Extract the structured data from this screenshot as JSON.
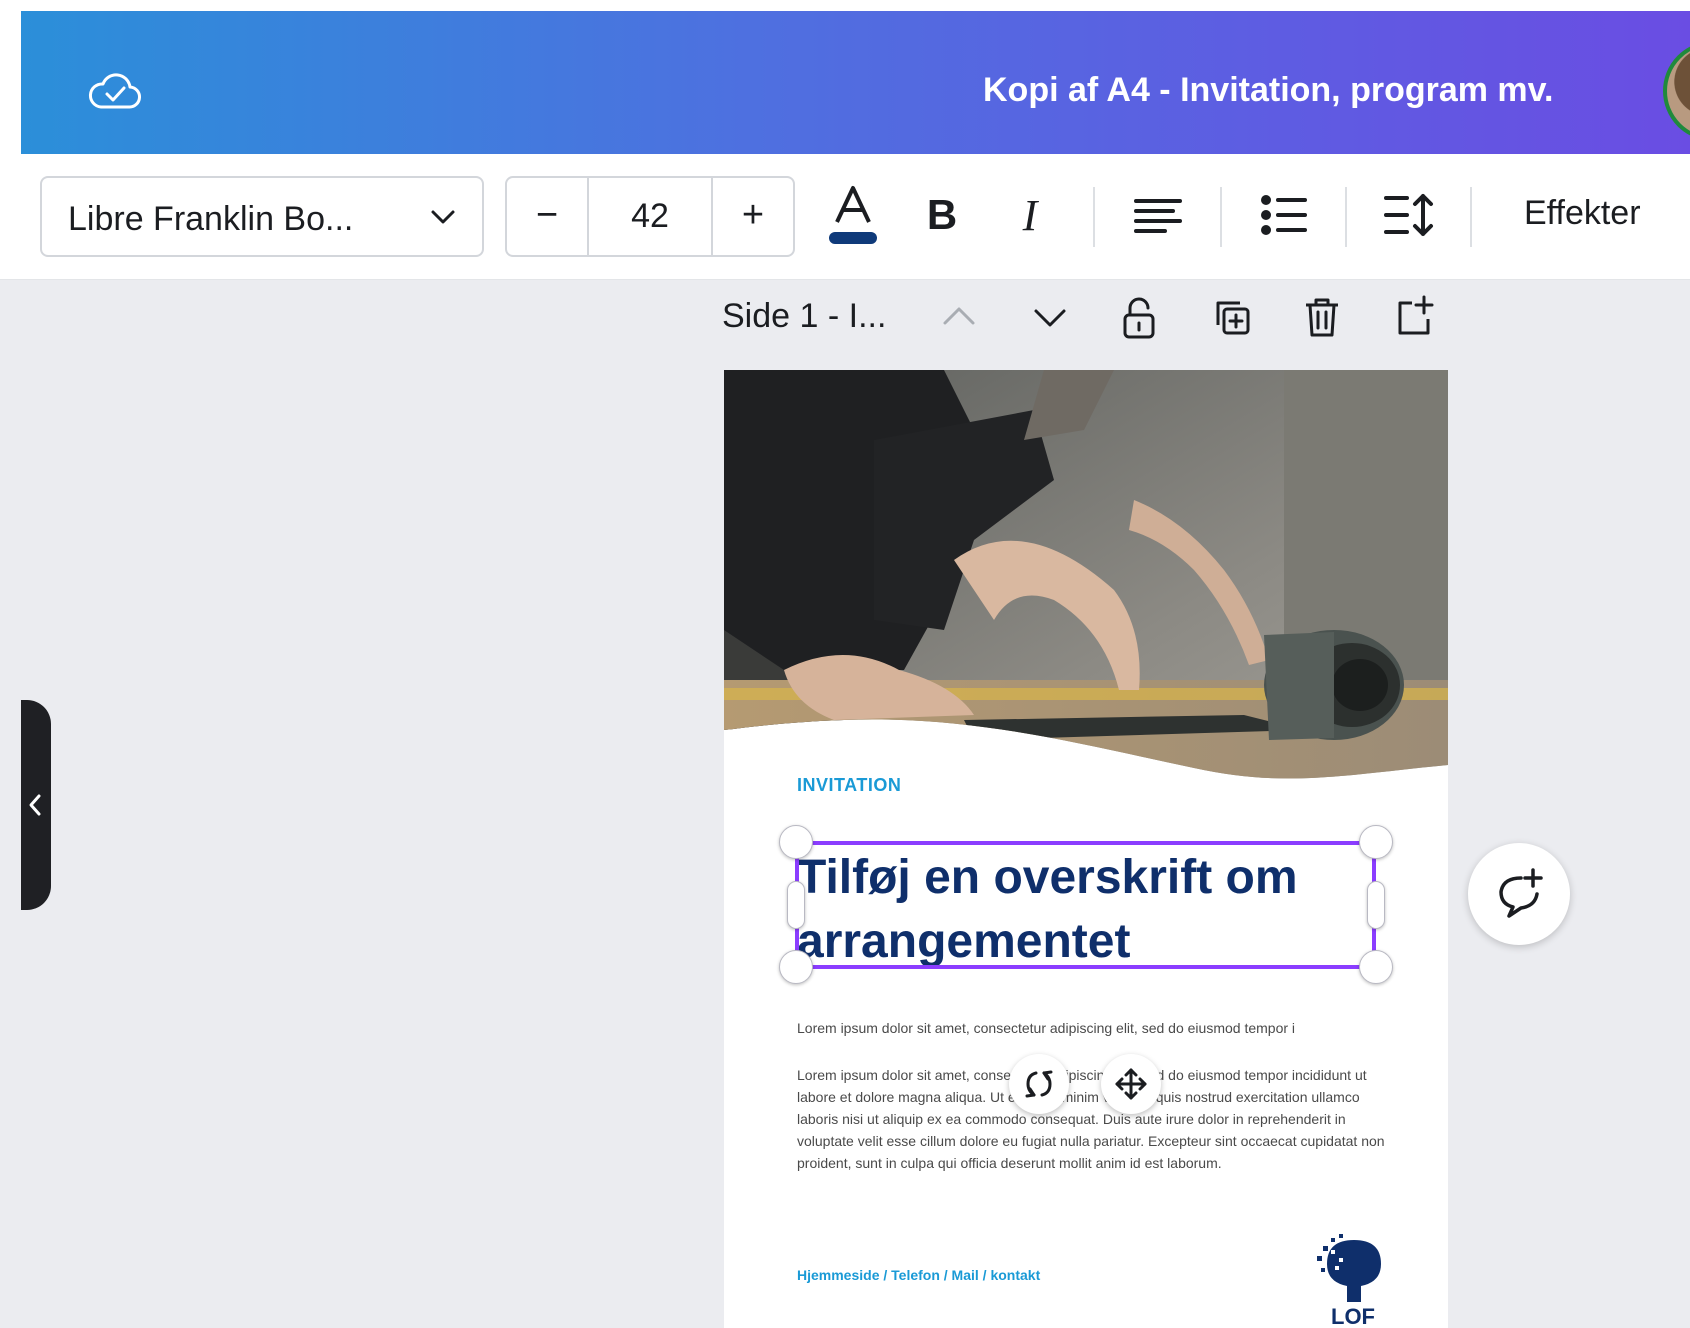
{
  "header": {
    "document_title": "Kopi af A4 - Invitation, program mv.",
    "cloud_icon": "cloud-check-icon",
    "avatar": "user-avatar"
  },
  "toolbar": {
    "font_family": "Libre Franklin Bo...",
    "font_size": "42",
    "minus": "−",
    "plus": "+",
    "effects_label": "Effekter",
    "text_color": "#0f3a7a",
    "icons": [
      "text-color-icon",
      "bold-icon",
      "italic-icon",
      "align-left-icon",
      "list-icon",
      "line-spacing-icon"
    ]
  },
  "page_header": {
    "title": "Side 1 - I...",
    "icons": [
      "chevron-up-icon",
      "chevron-down-icon",
      "lock-icon",
      "duplicate-page-icon",
      "trash-icon",
      "add-page-icon"
    ]
  },
  "page": {
    "invitation_label": "INVITATION",
    "headline": "Tilføj en overskrift om arrangementet",
    "lorem_short": "Lorem ipsum dolor sit amet, consectetur adipiscing elit, sed do eiusmod tempor i",
    "lorem_long": "Lorem ipsum dolor sit amet, consectetur adipiscing elit, sed do eiusmod tempor incididunt ut labore et dolore magna aliqua. Ut enim ad minim veniam, quis nostrud exercitation ullamco laboris nisi ut aliquip ex ea commodo consequat. Duis aute irure dolor in reprehenderit in voluptate velit esse cillum dolore eu fugiat nulla pariatur. Excepteur sint occaecat cupidatat non proident, sunt in culpa qui officia deserunt mollit anim id est laborum.",
    "contact": "Hjemmeside / Telefon / Mail / kontakt",
    "logo_text": "LOF"
  },
  "colors": {
    "header_gradient_start": "#2b8fd9",
    "header_gradient_end": "#6a4de3",
    "selection": "#8b3dff",
    "headline": "#0f2f6b",
    "accent_blue": "#1a9ad6"
  }
}
